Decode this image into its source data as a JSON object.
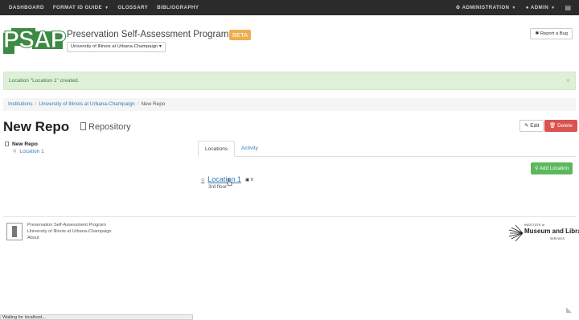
{
  "navbar": {
    "items": [
      "DASHBOARD",
      "FORMAT ID GUIDE",
      "GLOSSARY",
      "BIBLIOGRAPHY"
    ],
    "admin_menu": "ADMINISTRATION",
    "user_menu": "ADMIN"
  },
  "header": {
    "logo_text": "PSAP",
    "title": "Preservation Self-Assessment Program",
    "beta_badge": "BETA",
    "institution_select": "University of Illinois at Urbana-Champaign",
    "report_bug": "Report a Bug"
  },
  "alert": {
    "message": "Location \"Location 1\" created.",
    "close": "×"
  },
  "breadcrumb": {
    "items": [
      "Institutions",
      "University of Illinois at Urbana-Champaign"
    ],
    "active": "New Repo"
  },
  "page": {
    "title": "New Repo",
    "subtitle": "Repository",
    "edit_label": "Edit",
    "delete_label": "Delete"
  },
  "tree": {
    "root": "New Repo",
    "children": [
      "Location 1"
    ]
  },
  "tabs": [
    "Locations",
    "Activity"
  ],
  "locations": {
    "add_label": "Add Location",
    "items": [
      {
        "name": "Location 1",
        "count": "0",
        "description": "3rd floor"
      }
    ]
  },
  "footer": {
    "lines": [
      "Preservation Self-Assessment Program",
      "University of Illinois at Urbana-Champaign",
      "About"
    ],
    "imls_institute": "INSTITUTE of",
    "imls_name": "Museum and Library",
    "imls_services": "SERVICES"
  },
  "status_bar": "Waiting for localhost...",
  "colors": {
    "navbar": "#2b2b2b",
    "brand_green": "#3c8a44",
    "beta": "#f0ad4e",
    "alert_bg": "#dff0d8",
    "link": "#337ab7",
    "danger": "#d9534f",
    "success": "#5cb85c"
  }
}
